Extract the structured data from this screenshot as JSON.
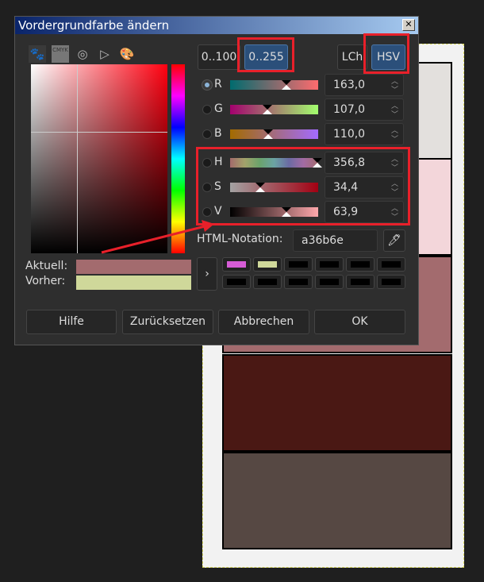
{
  "dialog": {
    "title": "Vordergrundfarbe ändern",
    "close": "✕"
  },
  "tabs": [
    "gimp-icon",
    "cmyk-icon",
    "watercolor-icon",
    "triangle-icon",
    "palette-icon"
  ],
  "cmyk_label": "CMYK",
  "range_buttons": {
    "r100": "0..100",
    "r255": "0..255",
    "lch": "LCh",
    "hsv": "HSV"
  },
  "channels": [
    {
      "label": "R",
      "value": "163,0",
      "pos": 0.64,
      "grad": "linear-gradient(90deg,#006b6e,#ff6b6e)"
    },
    {
      "label": "G",
      "value": "107,0",
      "pos": 0.42,
      "grad": "linear-gradient(90deg,#a3006e,#a3ff6e)"
    },
    {
      "label": "B",
      "value": "110,0",
      "pos": 0.43,
      "grad": "linear-gradient(90deg,#a36b00,#a36bff)"
    },
    {
      "label": "H",
      "value": "356,8",
      "pos": 0.99,
      "grad": "linear-gradient(90deg,#a36b6b,#a3a36b,#6ba36b,#6ba3a3,#6b6ba3,#a36ba3,#a36b6e)"
    },
    {
      "label": "S",
      "value": "34,4",
      "pos": 0.34,
      "grad": "linear-gradient(90deg,#a3a3a3,#a30012)"
    },
    {
      "label": "V",
      "value": "63,9",
      "pos": 0.64,
      "grad": "linear-gradient(90deg,#000,#ffa8ac)"
    }
  ],
  "html_notation": {
    "label": "HTML-Notation:",
    "value": "a36b6e"
  },
  "current": {
    "label": "Aktuell:",
    "color": "#a36b6e"
  },
  "previous": {
    "label": "Vorher:",
    "color": "#cfd89a"
  },
  "history": [
    "#d65cd6",
    "#cfd89a",
    "#000000",
    "#000000",
    "#000000",
    "#000000",
    "#000000",
    "#000000",
    "#000000",
    "#000000",
    "#000000",
    "#000000"
  ],
  "buttons": {
    "help": "Hilfe",
    "reset": "Zurücksetzen",
    "cancel": "Abbrechen",
    "ok": "OK"
  },
  "canvas_colors": [
    "#e3e0dd",
    "#f3d6da",
    "#a36b6e",
    "#4a1814",
    "#564843"
  ]
}
